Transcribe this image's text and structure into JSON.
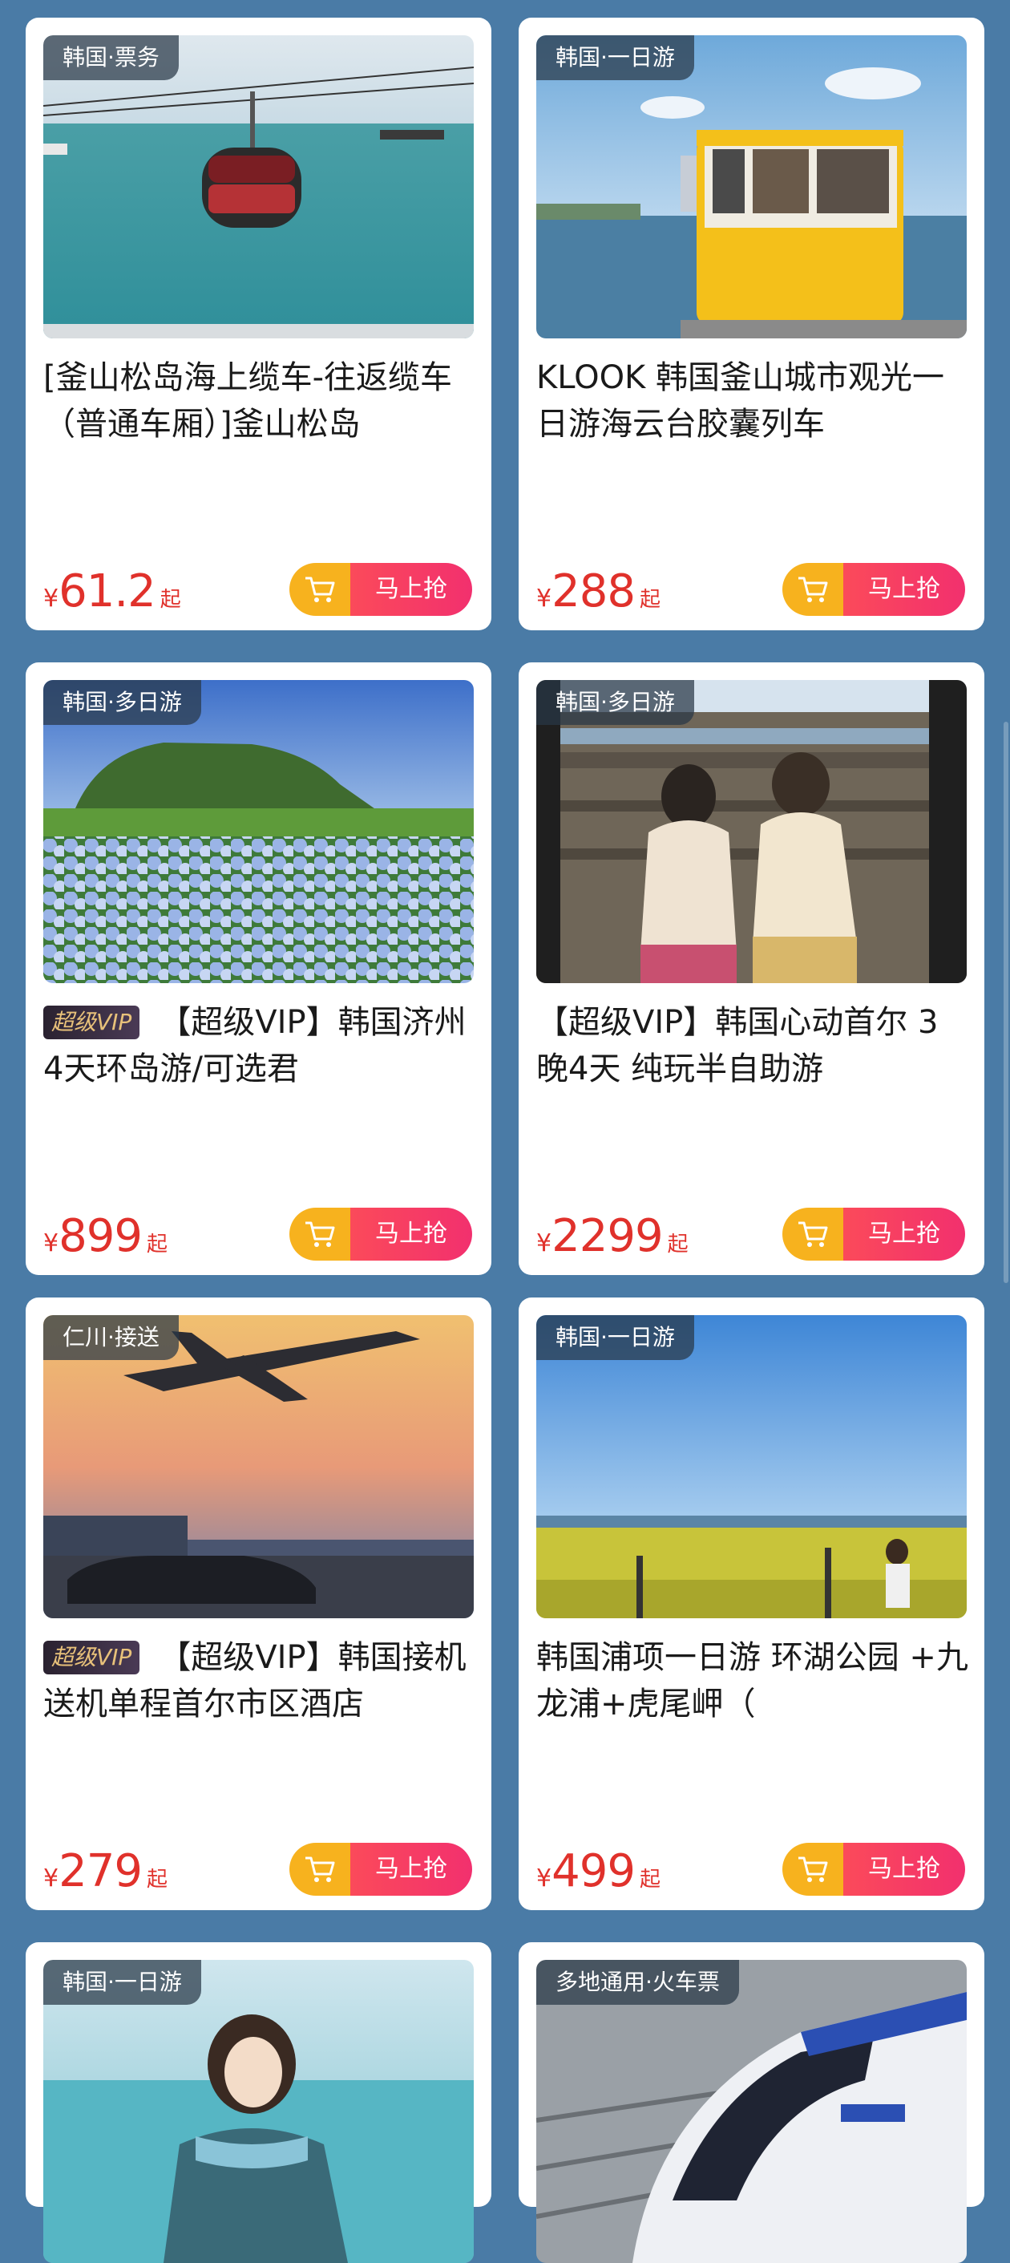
{
  "products": [
    {
      "tag": "韩国·票务",
      "title": "[釜山松岛海上缆车-往返缆车（普通车厢）]釜山松岛",
      "vip": "",
      "currency": "¥",
      "price": "61.2",
      "suffix": "起",
      "buy_label": "马上抢",
      "image": "sea-cable-car"
    },
    {
      "tag": "韩国·一日游",
      "title": "KLOOK 韩国釜山城市观光一日游海云台胶囊列车",
      "vip": "",
      "currency": "¥",
      "price": "288",
      "suffix": "起",
      "buy_label": "马上抢",
      "image": "yellow-capsule-train"
    },
    {
      "tag": "韩国·多日游",
      "title": "【超级VIP】韩国济州4天环岛游/可选君",
      "vip": "超级VIP",
      "currency": "¥",
      "price": "899",
      "suffix": "起",
      "buy_label": "马上抢",
      "image": "hydrangea-field"
    },
    {
      "tag": "韩国·多日游",
      "title": "【超级VIP】韩国心动首尔  3晚4天 纯玩半自助游",
      "vip": "",
      "currency": "¥",
      "price": "2299",
      "suffix": "起",
      "buy_label": "马上抢",
      "image": "hanbok-village"
    },
    {
      "tag": "仁川·接送",
      "title": "【超级VIP】韩国接机送机单程首尔市区酒店",
      "vip": "超级VIP",
      "currency": "¥",
      "price": "279",
      "suffix": "起",
      "buy_label": "马上抢",
      "image": "airport-plane"
    },
    {
      "tag": "韩国·一日游",
      "title": "韩国浦项一日游 环湖公园 +九龙浦+虎尾岬（",
      "vip": "",
      "currency": "¥",
      "price": "499",
      "suffix": "起",
      "buy_label": "马上抢",
      "image": "canola-field"
    },
    {
      "tag": "韩国·一日游",
      "title": "",
      "vip": "",
      "currency": "",
      "price": "",
      "suffix": "",
      "buy_label": "",
      "image": "beach-girl"
    },
    {
      "tag": "多地通用·火车票",
      "title": "",
      "vip": "",
      "currency": "",
      "price": "",
      "suffix": "",
      "buy_label": "",
      "image": "ktx-train"
    }
  ],
  "icons": {
    "cart": "cart-icon"
  },
  "colors": {
    "background": "#4a7ba6",
    "price": "#e0312b",
    "buy_button": "#f2306e",
    "cart_button": "#f7b21e"
  }
}
